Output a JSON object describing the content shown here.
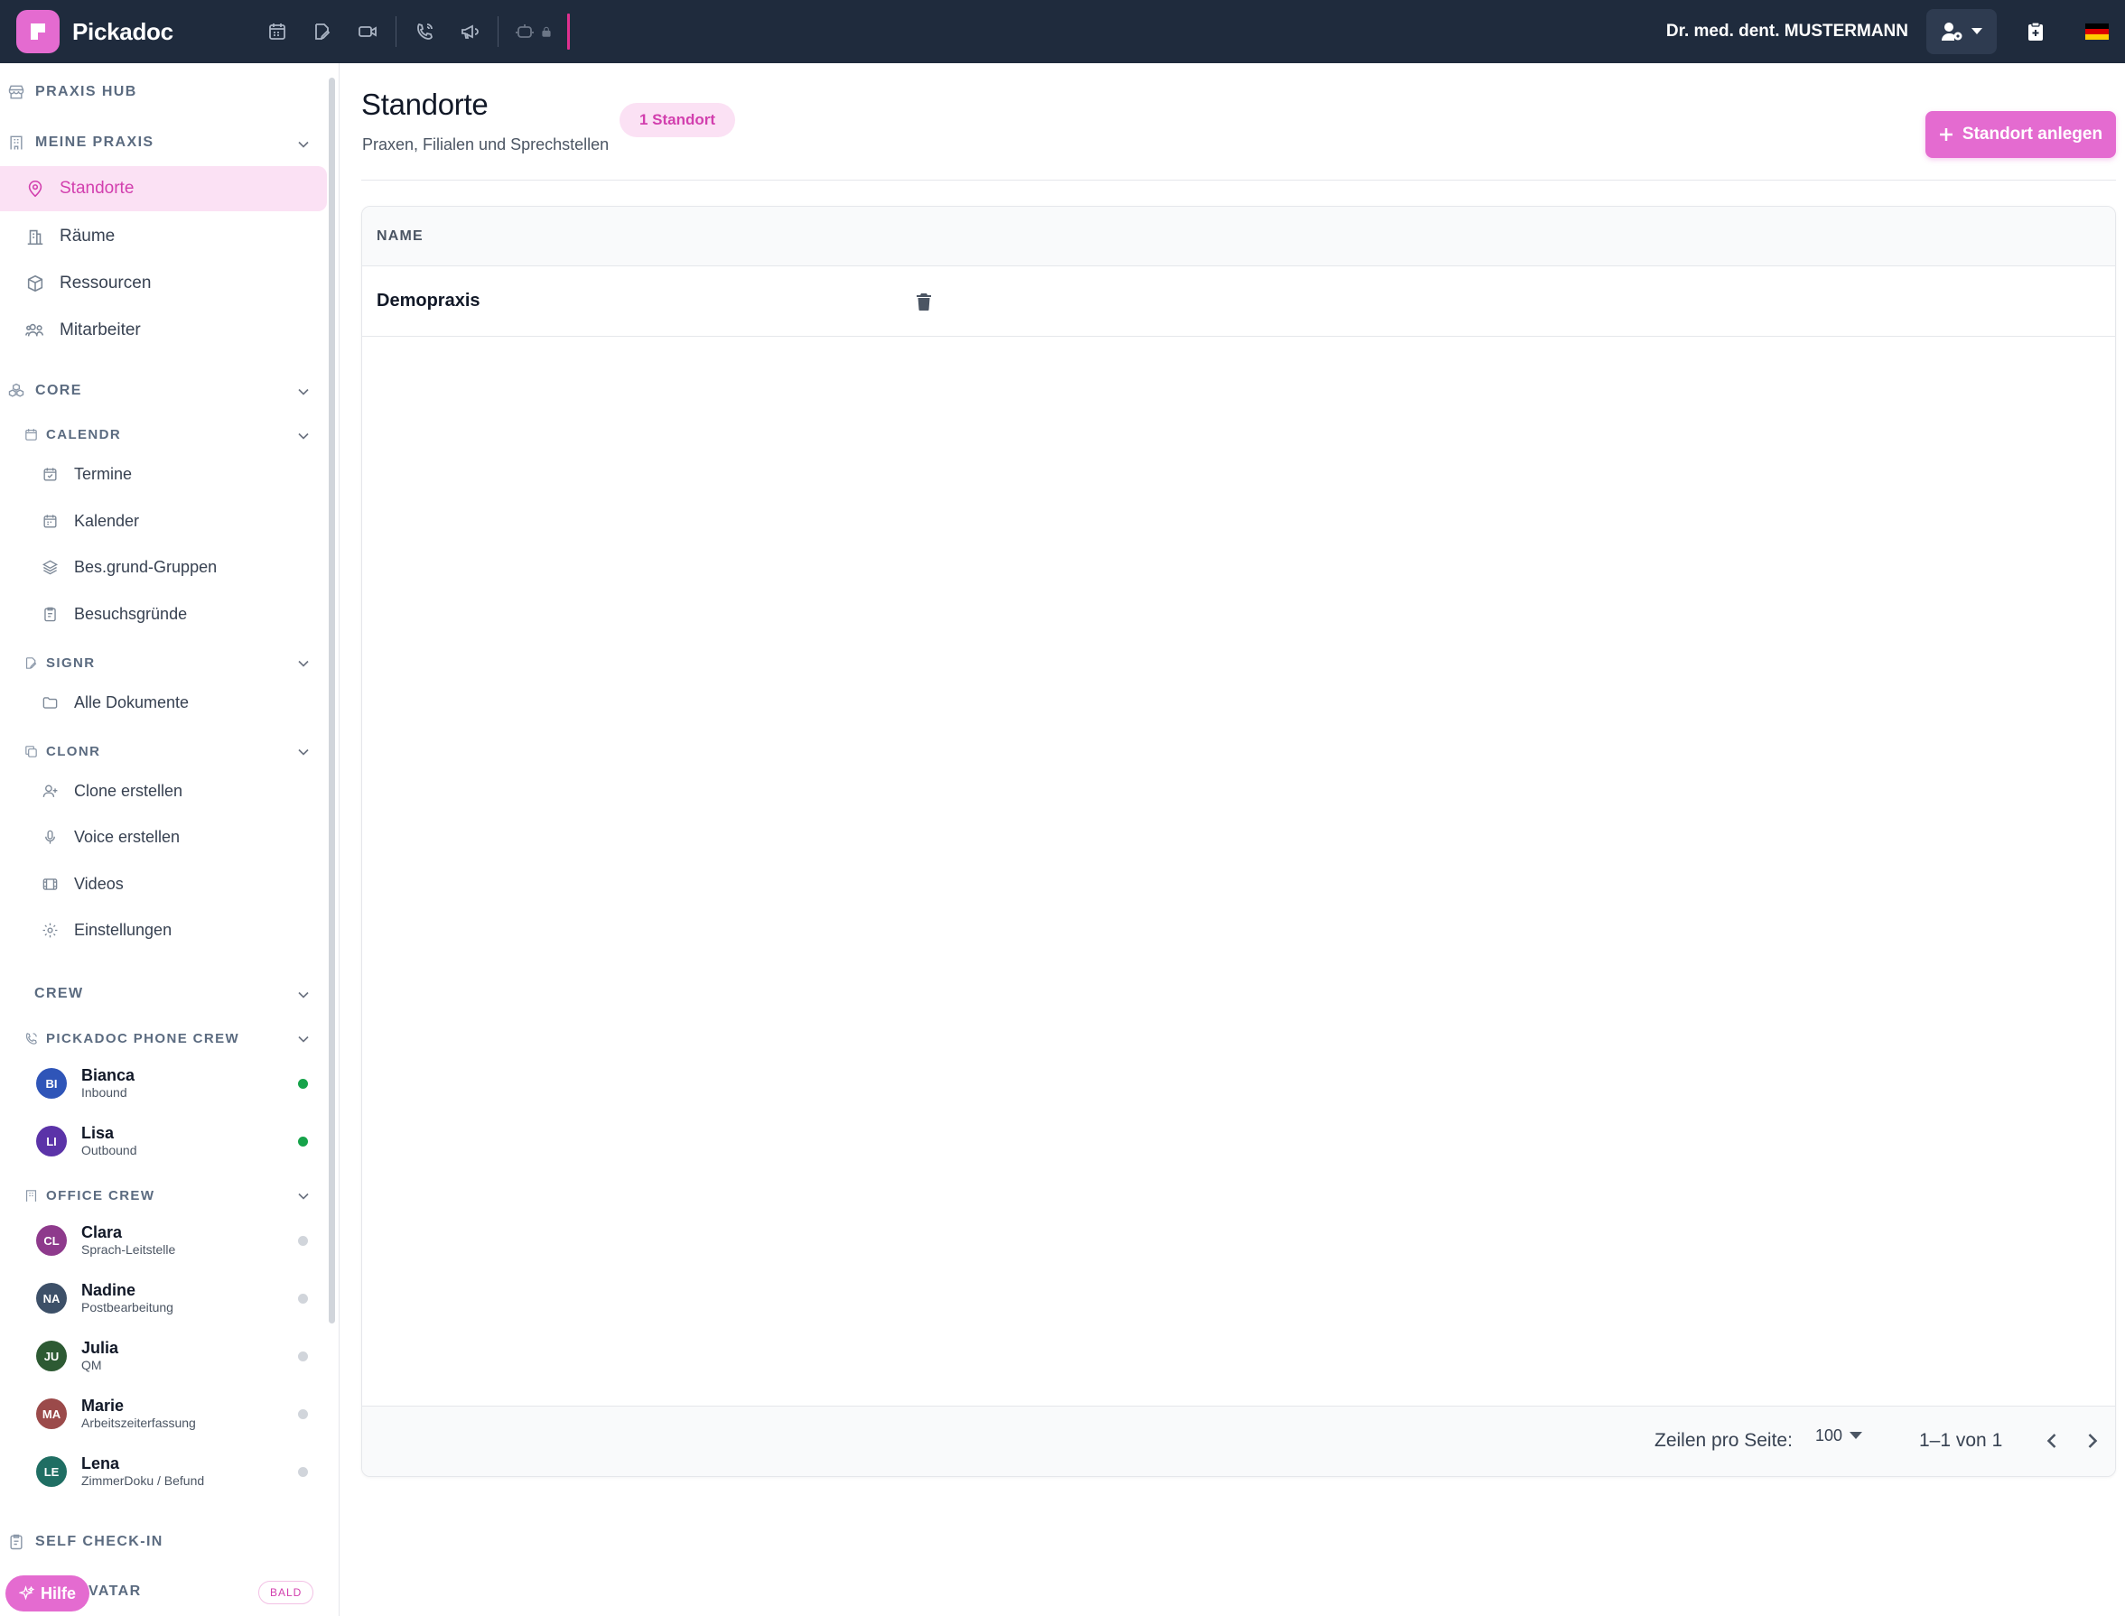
{
  "app": {
    "name": "Pickadoc"
  },
  "topbar": {
    "icons": [
      "calendar-icon",
      "sign-icon",
      "video-icon",
      "phone-icon",
      "megaphone-icon",
      "robot-icon",
      "lock-icon"
    ],
    "user_name": "Dr. med. dent. MUSTERMANN"
  },
  "sidebar": {
    "praxis_hub": "PRAXIS HUB",
    "meine_praxis": {
      "label": "MEINE PRAXIS",
      "items": [
        {
          "label": "Standorte",
          "icon": "map-pin-icon",
          "active": true
        },
        {
          "label": "Räume",
          "icon": "building-icon"
        },
        {
          "label": "Ressourcen",
          "icon": "box-icon"
        },
        {
          "label": "Mitarbeiter",
          "icon": "users-icon"
        }
      ]
    },
    "core": {
      "label": "CORE",
      "calendr": {
        "label": "CALENDR",
        "items": [
          {
            "label": "Termine",
            "icon": "calendar-check-icon"
          },
          {
            "label": "Kalender",
            "icon": "calendar-icon"
          },
          {
            "label": "Bes.grund-Gruppen",
            "icon": "layers-icon"
          },
          {
            "label": "Besuchsgründe",
            "icon": "clipboard-icon"
          }
        ]
      },
      "signr": {
        "label": "SIGNR",
        "items": [
          {
            "label": "Alle Dokumente",
            "icon": "folder-icon"
          }
        ]
      },
      "clonr": {
        "label": "CLONR",
        "items": [
          {
            "label": "Clone erstellen",
            "icon": "user-plus-icon"
          },
          {
            "label": "Voice erstellen",
            "icon": "microphone-icon"
          },
          {
            "label": "Videos",
            "icon": "film-icon"
          },
          {
            "label": "Einstellungen",
            "icon": "gear-icon"
          }
        ]
      }
    },
    "crew": {
      "label": "CREW",
      "phone_crew": {
        "label": "PICKADOC PHONE CREW",
        "members": [
          {
            "initials": "BI",
            "name": "Bianca",
            "role": "Inbound",
            "color": "#2f55b8",
            "status": "online"
          },
          {
            "initials": "LI",
            "name": "Lisa",
            "role": "Outbound",
            "color": "#5b33a8",
            "status": "online"
          }
        ]
      },
      "office_crew": {
        "label": "OFFICE CREW",
        "members": [
          {
            "initials": "CL",
            "name": "Clara",
            "role": "Sprach-Leitstelle",
            "color": "#8e3a8c",
            "status": "offline"
          },
          {
            "initials": "NA",
            "name": "Nadine",
            "role": "Postbearbeitung",
            "color": "#3d5068",
            "status": "offline"
          },
          {
            "initials": "JU",
            "name": "Julia",
            "role": "QM",
            "color": "#2d5a33",
            "status": "offline"
          },
          {
            "initials": "MA",
            "name": "Marie",
            "role": "Arbeitszeiterfassung",
            "color": "#9b4a4a",
            "status": "offline"
          },
          {
            "initials": "LE",
            "name": "Lena",
            "role": "ZimmerDoku / Befund",
            "color": "#1f6e63",
            "status": "offline"
          }
        ]
      }
    },
    "self_checkin": "SELF CHECK-IN",
    "avatar_label": "AVATAR",
    "avatar_visible_text": "VATAR",
    "bald_badge": "BALD",
    "help_label": "Hilfe"
  },
  "main": {
    "title": "Standorte",
    "subtitle": "Praxen, Filialen und Sprechstellen",
    "count_chip": "1 Standort",
    "add_button": "Standort anlegen",
    "table": {
      "columns": [
        "NAME"
      ],
      "rows": [
        {
          "name": "Demopraxis"
        }
      ]
    },
    "pagination": {
      "rows_per_page_label": "Zeilen pro Seite:",
      "rows_per_page_value": "100",
      "range_text": "1–1 von 1"
    }
  },
  "colors": {
    "topbar_bg": "#1f2b3d",
    "accent": "#e46bd0",
    "accent_text": "#d23fae",
    "accent_soft": "#fbe1f4",
    "status_online": "#16a34a",
    "status_offline": "#d1d5db"
  }
}
